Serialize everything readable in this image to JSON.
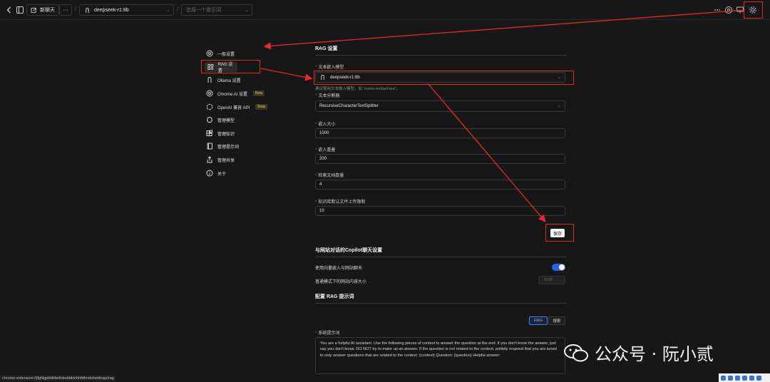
{
  "topbar": {
    "new_chat_label": "新聊天",
    "model_select": "deepseek-r1:8b",
    "prompt_placeholder": "选择一个提示词",
    "separator": "/"
  },
  "nav": {
    "items": [
      {
        "label": "一般设置",
        "icon": "gear-circle-icon"
      },
      {
        "label": "RAG 设置",
        "icon": "rag-grid-icon",
        "active": true
      },
      {
        "label": "Ollama 设置",
        "icon": "ollama-icon"
      },
      {
        "label": "Chrome AI 设置",
        "icon": "chrome-icon",
        "badge": "Beta"
      },
      {
        "label": "OpenAI 兼容 API",
        "icon": "openai-icon",
        "badge": "Beta"
      },
      {
        "label": "管理模型",
        "icon": "brain-icon"
      },
      {
        "label": "管理知识",
        "icon": "blocks-icon"
      },
      {
        "label": "管理提示词",
        "icon": "book-icon"
      },
      {
        "label": "管理共享",
        "icon": "share-icon"
      },
      {
        "label": "关于",
        "icon": "info-icon"
      }
    ]
  },
  "rag": {
    "title": "RAG 设置",
    "embed_model_label": "文本嵌入模型",
    "embed_model_value": "deepseek-r1:8b",
    "embed_model_hint": "建议使用文本嵌入模型，如 'nomic-embed-text'。",
    "splitter_label": "文本分割器",
    "splitter_value": "RecursiveCharacterTextSplitter",
    "chunk_size_label": "嵌入大小",
    "chunk_size_value": "1000",
    "chunk_overlap_label": "嵌入重叠",
    "chunk_overlap_value": "200",
    "retrieval_count_label": "检索文档数量",
    "retrieval_count_value": "4",
    "upload_limit_label": "知识库默认文件上传限制",
    "upload_limit_value": "10",
    "save_label": "保存"
  },
  "copilot": {
    "title": "与网站对话的Copilot聊天设置",
    "use_vector_label": "使用向量嵌入与网站聊天",
    "use_vector_on": true,
    "size_label": "普通模式下的网站内容大小",
    "size_value": "4028"
  },
  "prompt_config": {
    "title": "配置 RAG 提示词",
    "tab_rag": "RAG",
    "tab_search": "搜索",
    "system_prompt_label": "系统提示词",
    "system_prompt_value": "You are a helpful AI assistant. Use the following pieces of context to answer the question at the end. If you don't know the answer, just say you don't know. DO NOT try to make up an answer. If the question is not related to the context, politely respond that you are tuned to only answer questions that are related to the context.  {context}  Question: {question} Helpful answer:"
  },
  "statusbar": {
    "url": "chrome-extension://jfgfiigpkhlkbnfnbobbkinhhfdhndo/settings/rag"
  },
  "watermark": {
    "text": "公众号 · 阮小贰"
  },
  "colors": {
    "background": "#171717",
    "annotation_red": "#e02b2b",
    "toggle_blue": "#2563eb"
  }
}
